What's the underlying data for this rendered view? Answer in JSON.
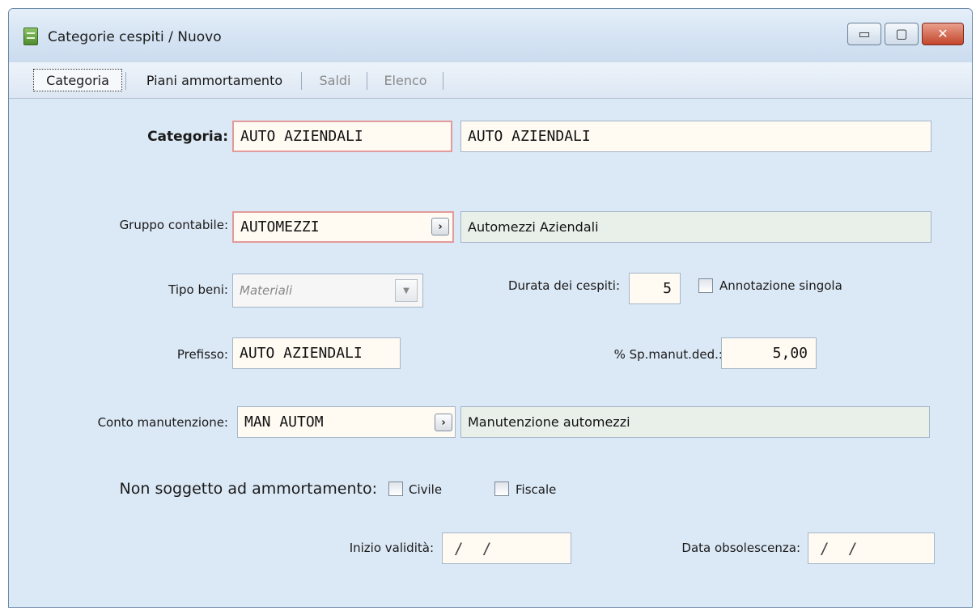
{
  "window": {
    "title": "Categorie cespiti / Nuovo",
    "minimize_label": "▭",
    "maximize_label": "▢",
    "close_label": "✕"
  },
  "tabs": [
    {
      "label": "Categoria",
      "state": "active"
    },
    {
      "label": "Piani ammortamento",
      "state": "enabled"
    },
    {
      "label": "Saldi",
      "state": "disabled"
    },
    {
      "label": "Elenco",
      "state": "disabled"
    }
  ],
  "form": {
    "categoria": {
      "label": "Categoria:",
      "code": "AUTO AZIENDALI",
      "description": "AUTO AZIENDALI"
    },
    "gruppo_contabile": {
      "label": "Gruppo contabile:",
      "code": "AUTOMEZZI",
      "description": "Automezzi Aziendali"
    },
    "tipo_beni": {
      "label": "Tipo beni:",
      "value": "Materiali",
      "arrow": "▼"
    },
    "durata": {
      "label": "Durata dei cespiti:",
      "value": "5"
    },
    "annotazione_singola": {
      "label": "Annotazione singola",
      "checked": false
    },
    "prefisso": {
      "label": "Prefisso:",
      "value": "AUTO AZIENDALI"
    },
    "sp_manut": {
      "label": "% Sp.manut.ded.:",
      "value": "5,00"
    },
    "conto_manutenzione": {
      "label": "Conto manutenzione:",
      "code": "MAN AUTOM",
      "description": "Manutenzione automezzi"
    },
    "non_soggetto": {
      "label": "Non soggetto ad ammortamento:",
      "civile": "Civile",
      "fiscale": "Fiscale"
    },
    "inizio_validita": {
      "label": "Inizio validità:",
      "value": "/ /"
    },
    "data_obsolescenza": {
      "label": "Data obsolescenza:",
      "value": "/ /"
    },
    "zoom_glyph": "›"
  },
  "colors": {
    "background": "#dbe8f5",
    "required_border": "#e39a9a",
    "readonly_fill": "#e9f0ea"
  }
}
